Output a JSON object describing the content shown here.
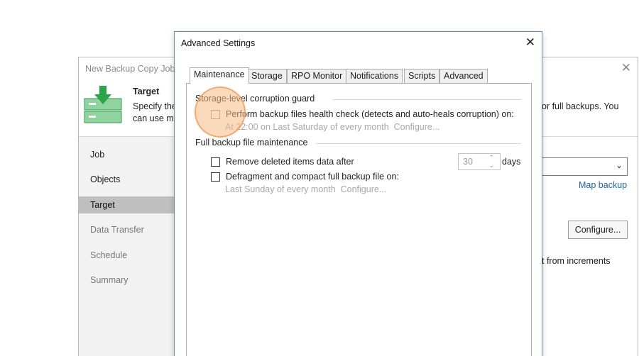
{
  "wizard": {
    "title": "New Backup Copy Job",
    "header": {
      "title": "Target",
      "description_line1": "Specify the",
      "description_line2": "can use m",
      "description_right": "or full backups. You"
    },
    "nav": [
      {
        "label": "Job",
        "state": "done"
      },
      {
        "label": "Objects",
        "state": "done"
      },
      {
        "label": "Target",
        "state": "active"
      },
      {
        "label": "Data Transfer",
        "state": "todo"
      },
      {
        "label": "Schedule",
        "state": "todo"
      },
      {
        "label": "Summary",
        "state": "todo"
      }
    ],
    "map_backup_link": "Map backup",
    "configure_button": "Configure...",
    "increments_text": "t from increments"
  },
  "dialog": {
    "title": "Advanced Settings",
    "tabs": [
      "Maintenance",
      "Storage",
      "RPO Monitor",
      "Notifications",
      "Scripts",
      "Advanced"
    ],
    "active_tab": "Maintenance",
    "storage_guard": {
      "title": "Storage-level corruption guard",
      "health_check_label": "Perform backup files health check (detects and auto-heals corruption) on:",
      "health_check_schedule": "At 22:00 on Last Saturday of every month",
      "health_check_configure": "Configure..."
    },
    "full_maintenance": {
      "title": "Full backup file maintenance",
      "remove_deleted_label": "Remove deleted items data after",
      "remove_deleted_value": "30",
      "remove_deleted_unit": "days",
      "defragment_label": "Defragment and compact full backup file on:",
      "defragment_schedule": "Last Sunday of every month",
      "defragment_configure": "Configure..."
    }
  },
  "colors": {
    "link": "#1f64b5",
    "highlight": "#f7bc84",
    "dialog_border": "#6b8fb4",
    "nav_active": "#bfbfbf"
  }
}
